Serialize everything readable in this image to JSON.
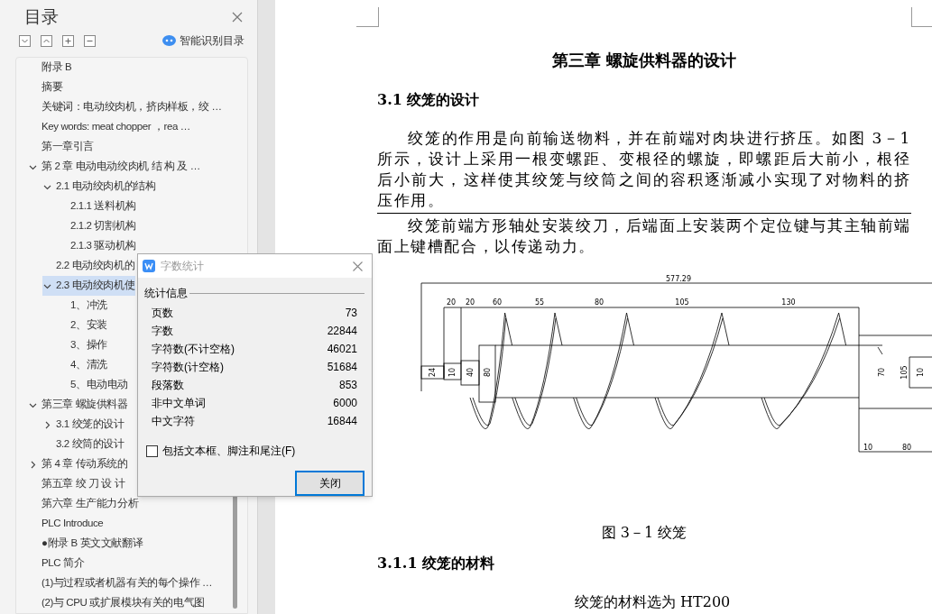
{
  "sidebar": {
    "title": "目录",
    "smart_button": "智能识别目录",
    "tree": [
      {
        "label": "附录 B",
        "selected": false
      },
      {
        "label": "摘要",
        "selected": false
      },
      {
        "label": "关键词：电动绞肉机，挤肉样板，绞 …",
        "selected": false
      },
      {
        "label": "Key words: meat chopper ，rea …",
        "selected": false
      },
      {
        "label": "第一章引言",
        "selected": false
      },
      {
        "label": "第 2 章  电动电动绞肉机 结 构 及 …",
        "selected": false,
        "expanded": true,
        "children": [
          {
            "label": "2.1 电动绞肉机的结构",
            "selected": false,
            "expanded": true,
            "children": [
              {
                "label": "2.1.1 送料机构",
                "selected": false
              },
              {
                "label": "2.1.2 切割机构",
                "selected": false
              },
              {
                "label": "2.1.3 驱动机构",
                "selected": false
              }
            ]
          },
          {
            "label": "2.2 电动绞肉机的",
            "selected": false
          },
          {
            "label": "2.3 电动绞肉机使",
            "selected": true,
            "expanded": true,
            "children": [
              {
                "label": "1、冲洗",
                "selected": false
              },
              {
                "label": "2、安装",
                "selected": false
              },
              {
                "label": "3、操作",
                "selected": false
              },
              {
                "label": "4、清洗",
                "selected": false
              },
              {
                "label": "5、电动电动",
                "selected": false
              }
            ]
          }
        ]
      },
      {
        "label": "第三章  螺旋供料器",
        "selected": false,
        "expanded": true,
        "children": [
          {
            "label": "3.1 绞笼的设计",
            "selected": false,
            "expanded": false
          },
          {
            "label": "3.2 绞筒的设计",
            "selected": false
          }
        ]
      },
      {
        "label": "第 4 章  传动系统的",
        "selected": false,
        "expanded": false
      },
      {
        "label": "第五章  绞  刀  设  计",
        "selected": false
      },
      {
        "label": "第六章  生产能力分析",
        "selected": false
      },
      {
        "label": "PLC Introduce",
        "selected": false
      },
      {
        "label": "●附录 B 英文文献翻译",
        "selected": false
      },
      {
        "label": "PLC 简介",
        "selected": false
      },
      {
        "label": "(1)与过程或者机器有关的每个操作 …",
        "selected": false
      },
      {
        "label": "(2)与 CPU 或扩展模块有关的电气图",
        "selected": false
      }
    ]
  },
  "dialog": {
    "title": "字数统计",
    "group_label": "统计信息",
    "stats": [
      {
        "label": "页数",
        "value": "73"
      },
      {
        "label": "字数",
        "value": "22844"
      },
      {
        "label": "字符数(不计空格)",
        "value": "46021"
      },
      {
        "label": "字符数(计空格)",
        "value": "51684"
      },
      {
        "label": "段落数",
        "value": "853"
      },
      {
        "label": "非中文单词",
        "value": "6000"
      },
      {
        "label": "中文字符",
        "value": "16844"
      }
    ],
    "checkbox": {
      "label": "包括文本框、脚注和尾注(F)",
      "checked": false
    },
    "button": "关闭"
  },
  "document": {
    "chapter_title": "第三章  螺旋供料器的设计",
    "section_title": "3.1 绞笼的设计",
    "paragraphs": [
      "绞笼的作用是向前输送物料，并在前端对肉块进行挤压。如图 3－1 所示，设计上采用一根变螺距、变根径的螺旋，即螺距后大前小，根径后小前大，这样使其绞笼与绞筒之间的容积逐渐减小实现了对物料的挤压作用。",
      "绞笼前端方形轴处安装绞刀，后端面上安装两个定位键与其主轴前端面上键槽配合，以传递动力。"
    ],
    "figure": {
      "dimension_labels": [
        "577.29",
        "20",
        "20",
        "60",
        "55",
        "80",
        "105",
        "130",
        "24",
        "10",
        "40",
        "80",
        "70",
        "105",
        "10",
        "10",
        "80"
      ]
    },
    "caption": "图 3－1  绞笼",
    "subsection_title": "3.1.1 绞笼的材料",
    "body_line": "绞笼的材料选为 HT200"
  }
}
